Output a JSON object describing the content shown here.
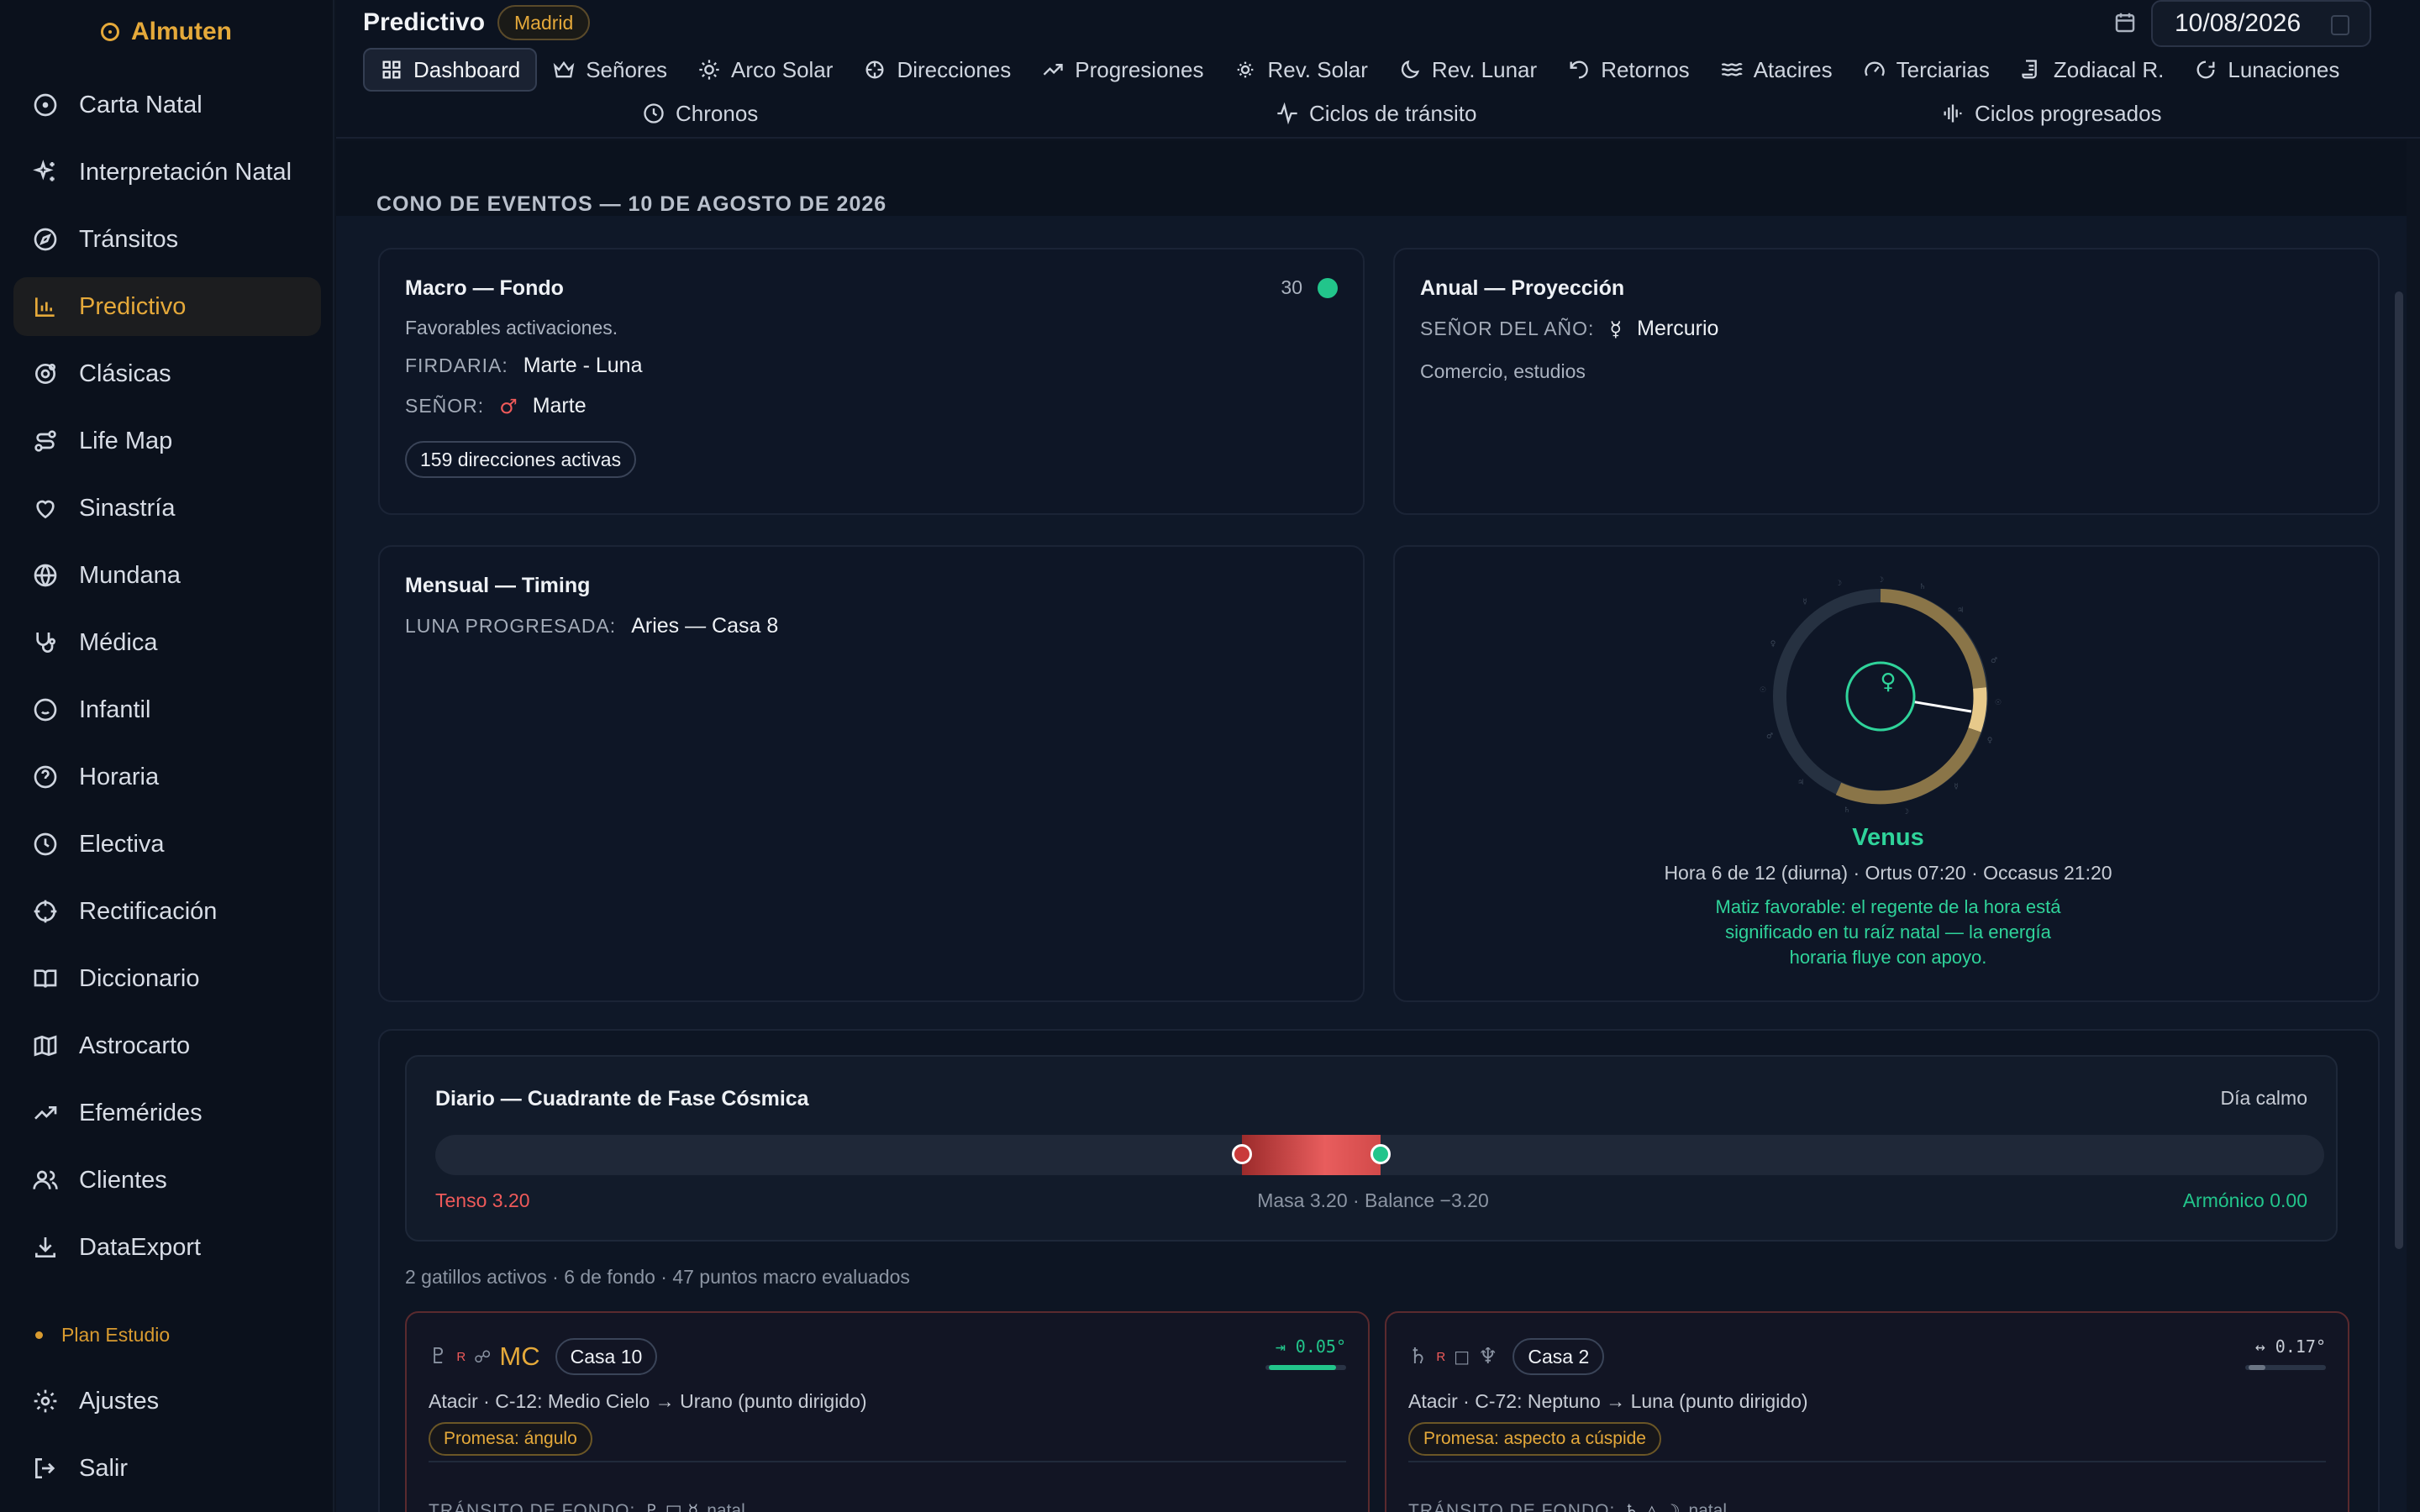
{
  "app": {
    "brand": "Almuten"
  },
  "sidebar": {
    "items": [
      {
        "label": "Carta Natal"
      },
      {
        "label": "Interpretación Natal"
      },
      {
        "label": "Tránsitos"
      },
      {
        "label": "Predictivo"
      },
      {
        "label": "Clásicas"
      },
      {
        "label": "Life Map"
      },
      {
        "label": "Sinastría"
      },
      {
        "label": "Mundana"
      },
      {
        "label": "Médica"
      },
      {
        "label": "Infantil"
      },
      {
        "label": "Horaria"
      },
      {
        "label": "Electiva"
      },
      {
        "label": "Rectificación"
      },
      {
        "label": "Diccionario"
      },
      {
        "label": "Astrocarto"
      },
      {
        "label": "Efemérides"
      },
      {
        "label": "Clientes"
      },
      {
        "label": "DataExport"
      }
    ],
    "active_index": 3,
    "plan": "Plan Estudio",
    "bottom": [
      {
        "label": "Ajustes"
      },
      {
        "label": "Salir"
      }
    ]
  },
  "header": {
    "title": "Predictivo",
    "location": "Madrid",
    "date": "10/08/2026",
    "tabs_row1": [
      {
        "label": "Dashboard",
        "icon": "grid-icon"
      },
      {
        "label": "Señores",
        "icon": "crown-icon"
      },
      {
        "label": "Arco Solar",
        "icon": "sun-icon"
      },
      {
        "label": "Direcciones",
        "icon": "crosshair-icon"
      },
      {
        "label": "Progresiones",
        "icon": "trend-icon"
      },
      {
        "label": "Rev. Solar",
        "icon": "sun-small-icon"
      },
      {
        "label": "Rev. Lunar",
        "icon": "moon-icon"
      },
      {
        "label": "Retornos",
        "icon": "rotate-icon"
      },
      {
        "label": "Atacires",
        "icon": "waves-icon"
      },
      {
        "label": "Terciarias",
        "icon": "gauge-icon"
      },
      {
        "label": "Zodiacal R.",
        "icon": "scroll-icon"
      },
      {
        "label": "Lunaciones",
        "icon": "moon-cycle-icon"
      }
    ],
    "tabs_row2": [
      {
        "label": "Chronos",
        "icon": "clock-icon"
      },
      {
        "label": "Ciclos de tránsito",
        "icon": "pulse-icon"
      },
      {
        "label": "Ciclos progresados",
        "icon": "audio-icon"
      }
    ]
  },
  "main": {
    "section_title": "CONO DE EVENTOS — 10 DE AGOSTO DE 2026",
    "macro": {
      "title": "Macro — Fondo",
      "score": "30",
      "status_color": "#22c58b",
      "subtitle": "Favorables activaciones.",
      "firdaria_label": "FIRDARIA:",
      "firdaria_value": "Marte - Luna",
      "senor_label": "SEÑOR:",
      "senor_glyph": "♂",
      "senor_value": "Marte",
      "chip": "159 direcciones activas"
    },
    "anual": {
      "title": "Anual — Proyección",
      "senor_label": "SEÑOR DEL AÑO:",
      "senor_glyph": "☿",
      "senor_value": "Mercurio",
      "note": "Comercio, estudios"
    },
    "mensual": {
      "title": "Mensual — Timing",
      "luna_label": "LUNA PROGRESADA:",
      "luna_value": "Aries — Casa 8"
    },
    "hora": {
      "planet_glyph": "♀",
      "planet": "Venus",
      "detail": "Hora 6 de 12 (diurna) · Ortus 07:20 · Occasus 21:20",
      "message": "Matiz favorable: el regente de la hora está significado en tu raíz natal — la energía horaria fluye con apoyo.",
      "accent": "#2fd39a"
    },
    "diario": {
      "title": "Diario — Cuadrante de Fase Cósmica",
      "status": "Día calmo",
      "tenso": "Tenso 3.20",
      "center": "Masa 3.20 · Balance −3.20",
      "armonico": "Armónico 0.00"
    },
    "summary": "2 gatillos activos · 6 de fondo · 47 puntos macro evaluados",
    "triggers": [
      {
        "glyphs": "♇",
        "retro": "R",
        "aspect": "☍",
        "target": "MC",
        "house": "Casa 10",
        "orb": "⇥ 0.05°",
        "orb_fraction": 0.83,
        "desc": "Atacir · C-12: Medio Cielo → Urano (punto dirigido)",
        "promise": "Promesa: ángulo",
        "fondo_label": "TRÁNSITO DE FONDO:",
        "fondo_glyphs": "♇ □ ☿",
        "fondo_suffix": "natal"
      },
      {
        "glyphs": "♄",
        "retro": "R",
        "aspect": "□",
        "target": "♆",
        "house": "Casa 2",
        "orb": "↔ 0.17°",
        "orb_fraction": 0.2,
        "desc": "Atacir · C-72: Neptuno → Luna (punto dirigido)",
        "promise": "Promesa: aspecto a cúspide",
        "fondo_label": "TRÁNSITO DE FONDO:",
        "fondo_glyphs": "♄ △ ☽",
        "fondo_suffix": "natal"
      }
    ]
  },
  "colors": {
    "accent_gold": "#e5a93a",
    "green": "#22c58b",
    "red": "#ef5a5a"
  }
}
